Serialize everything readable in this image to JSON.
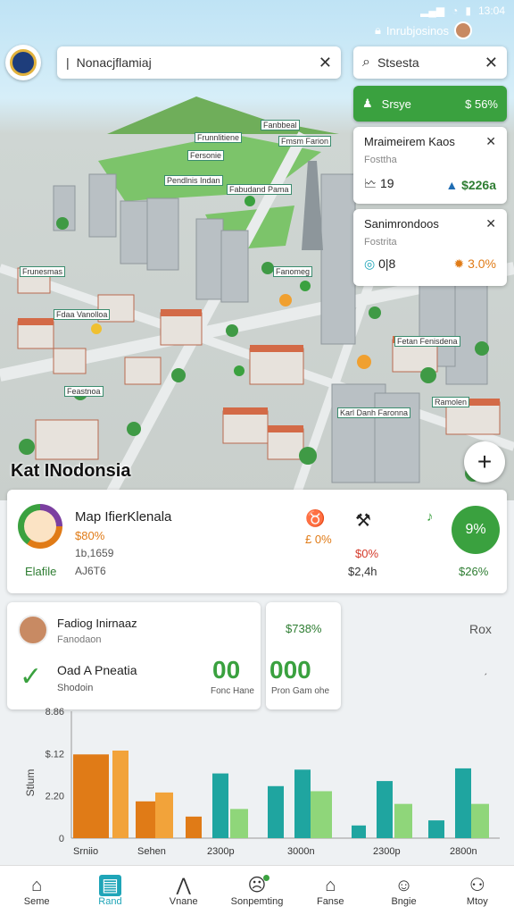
{
  "statusbar": {
    "time": "13:04"
  },
  "header": {
    "user_label": "Inrubjosinos",
    "search_left": {
      "value": "Nonacjflamiaj"
    },
    "search_right": {
      "value": "Stsesta"
    }
  },
  "map": {
    "title": "Kat INodonsia",
    "labels": [
      "Fanbbeal",
      "Frunnlitiene",
      "Fmsm Farion",
      "Fersonie",
      "Pendlnis Indan",
      "Fabudand Pama",
      "Frunesmas",
      "Fanomeg",
      "Fdaa Vanolloa",
      "Fetan Fenisdena",
      "Karl Danh Faronna",
      "Feastnoa",
      "Ramolen"
    ]
  },
  "green_button": {
    "label": "Srsye",
    "value": "$ 56%"
  },
  "info_cards": [
    {
      "title": "Mraimeirem Kaos",
      "subtitle": "Fosttha",
      "count": "19",
      "value": "$226a"
    },
    {
      "title": "Sanimrondoos",
      "subtitle": "Fostrita",
      "count": "0|8",
      "value": "3.0%"
    }
  ],
  "summary": {
    "title": "Map IfierKlenala",
    "pct1": "$80%",
    "label_left": "Elafile",
    "line2": "1b,1659",
    "line3": "AJ6T6",
    "pct2": "£ 0%",
    "pct3": "$0%",
    "amount": "$2,4h",
    "circle_value": "9%",
    "pct4": "$26%"
  },
  "profile": {
    "name": "Fadiog Inirnaaz",
    "role": "Fanodaon",
    "metric": "Oad A Pneatia",
    "metric_sub": "Shodoin",
    "big_value": "00",
    "big_label": "Fonc Hane"
  },
  "stats": {
    "pct": "$738%",
    "big_value": "000",
    "big_label": "Pron Gam ohe"
  },
  "rox_label": "Rox",
  "chart_data": {
    "type": "bar",
    "ylabel": "Stlum",
    "ytick_labels": [
      "8.86",
      "$.12",
      "2.20",
      "0"
    ],
    "xtick_labels": [
      "Srniio",
      "Sehen",
      "2300p",
      "3000n",
      "2300p",
      "2800n"
    ],
    "series": [
      {
        "color": "#e07b17",
        "values": [
          0.66,
          0.29,
          0.17
        ]
      },
      {
        "color": "#f2a33a",
        "values": [
          0.69,
          0.36
        ]
      },
      {
        "color": "#1fa5a0",
        "values": [
          0.51,
          0.41,
          0.54,
          0.1,
          0.45,
          0.14,
          0.55
        ]
      },
      {
        "color": "#8fd67a",
        "values": [
          0.23,
          0.37,
          0.27,
          0.27
        ]
      }
    ]
  },
  "bottom_nav": [
    {
      "label": "Seme",
      "icon": "home-icon"
    },
    {
      "label": "Rand",
      "icon": "folder-icon"
    },
    {
      "label": "Vnane",
      "icon": "mountain-icon"
    },
    {
      "label": "Sonpemting",
      "icon": "face-icon"
    },
    {
      "label": "Fanse",
      "icon": "house-icon"
    },
    {
      "label": "Bngie",
      "icon": "emoji-icon"
    },
    {
      "label": "Mtoy",
      "icon": "people-icon"
    }
  ]
}
